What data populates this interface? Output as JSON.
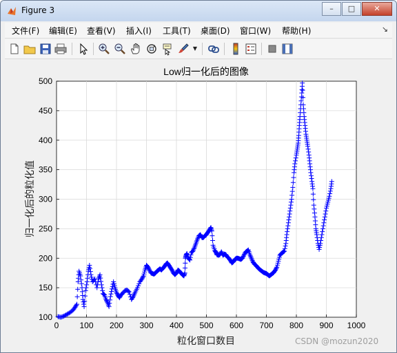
{
  "window": {
    "title": "Figure 3",
    "minimize_label": "–",
    "maximize_label": "□",
    "close_label": "✕"
  },
  "menu": [
    {
      "label": "文件(F)"
    },
    {
      "label": "编辑(E)"
    },
    {
      "label": "查看(V)"
    },
    {
      "label": "插入(I)"
    },
    {
      "label": "工具(T)"
    },
    {
      "label": "桌面(D)"
    },
    {
      "label": "窗口(W)"
    },
    {
      "label": "帮助(H)"
    }
  ],
  "menu_grip": "↘",
  "toolbar": {
    "icons": [
      "new-file-icon",
      "open-folder-icon",
      "save-icon",
      "print-icon",
      "pointer-icon",
      "zoom-in-icon",
      "zoom-out-icon",
      "pan-hand-icon",
      "rotate-3d-icon",
      "data-cursor-icon",
      "brush-icon",
      "brush-dropdown-icon",
      "link-plot-icon",
      "colorbar-icon",
      "legend-icon",
      "hide-plot-tools-icon",
      "show-plot-tools-icon"
    ]
  },
  "colors": {
    "marker": "#0000ff",
    "grid": "#d9d9d9",
    "axes_bg": "#ffffff",
    "figure_bg": "#f0f0f0"
  },
  "chart_data": {
    "type": "scatter",
    "title": "Low归一化后的图像",
    "xlabel": "粒化窗口数目",
    "ylabel": "归一化后的粒化值",
    "xlim": [
      0,
      1000
    ],
    "ylim": [
      100,
      500
    ],
    "xticks": [
      "0",
      "100",
      "200",
      "300",
      "400",
      "500",
      "600",
      "700",
      "800",
      "900",
      "1000"
    ],
    "yticks": [
      "100",
      "150",
      "200",
      "250",
      "300",
      "350",
      "400",
      "450",
      "500"
    ],
    "grid": true,
    "marker": "+",
    "series": [
      {
        "points": [
          [
            5,
            101
          ],
          [
            15,
            100
          ],
          [
            25,
            102
          ],
          [
            35,
            105
          ],
          [
            45,
            108
          ],
          [
            55,
            112
          ],
          [
            62,
            117
          ],
          [
            68,
            122
          ],
          [
            72,
            160
          ],
          [
            75,
            178
          ],
          [
            80,
            170
          ],
          [
            85,
            150
          ],
          [
            88,
            130
          ],
          [
            92,
            118
          ],
          [
            97,
            145
          ],
          [
            102,
            160
          ],
          [
            106,
            178
          ],
          [
            110,
            188
          ],
          [
            115,
            172
          ],
          [
            120,
            160
          ],
          [
            128,
            165
          ],
          [
            135,
            150
          ],
          [
            140,
            165
          ],
          [
            145,
            172
          ],
          [
            150,
            155
          ],
          [
            155,
            140
          ],
          [
            160,
            138
          ],
          [
            165,
            130
          ],
          [
            170,
            125
          ],
          [
            175,
            118
          ],
          [
            180,
            135
          ],
          [
            185,
            148
          ],
          [
            190,
            160
          ],
          [
            195,
            150
          ],
          [
            200,
            142
          ],
          [
            205,
            137
          ],
          [
            210,
            133
          ],
          [
            215,
            138
          ],
          [
            220,
            140
          ],
          [
            228,
            145
          ],
          [
            235,
            146
          ],
          [
            242,
            143
          ],
          [
            250,
            130
          ],
          [
            256,
            135
          ],
          [
            262,
            142
          ],
          [
            270,
            150
          ],
          [
            278,
            160
          ],
          [
            285,
            165
          ],
          [
            290,
            170
          ],
          [
            295,
            180
          ],
          [
            300,
            188
          ],
          [
            305,
            185
          ],
          [
            310,
            180
          ],
          [
            315,
            175
          ],
          [
            320,
            174
          ],
          [
            325,
            173
          ],
          [
            330,
            175
          ],
          [
            335,
            178
          ],
          [
            340,
            180
          ],
          [
            345,
            182
          ],
          [
            350,
            180
          ],
          [
            355,
            183
          ],
          [
            360,
            186
          ],
          [
            365,
            190
          ],
          [
            370,
            192
          ],
          [
            375,
            188
          ],
          [
            380,
            184
          ],
          [
            385,
            180
          ],
          [
            390,
            175
          ],
          [
            395,
            172
          ],
          [
            400,
            175
          ],
          [
            405,
            180
          ],
          [
            410,
            178
          ],
          [
            415,
            175
          ],
          [
            420,
            172
          ],
          [
            425,
            170
          ],
          [
            428,
            175
          ],
          [
            430,
            200
          ],
          [
            432,
            205
          ],
          [
            435,
            208
          ],
          [
            440,
            200
          ],
          [
            445,
            197
          ],
          [
            450,
            210
          ],
          [
            455,
            212
          ],
          [
            460,
            218
          ],
          [
            465,
            225
          ],
          [
            470,
            232
          ],
          [
            475,
            238
          ],
          [
            480,
            240
          ],
          [
            485,
            235
          ],
          [
            490,
            235
          ],
          [
            495,
            238
          ],
          [
            500,
            240
          ],
          [
            505,
            244
          ],
          [
            510,
            248
          ],
          [
            515,
            252
          ],
          [
            518,
            246
          ],
          [
            522,
            222
          ],
          [
            528,
            213
          ],
          [
            532,
            210
          ],
          [
            535,
            206
          ],
          [
            540,
            205
          ],
          [
            545,
            206
          ],
          [
            550,
            211
          ],
          [
            555,
            205
          ],
          [
            560,
            207
          ],
          [
            565,
            206
          ],
          [
            570,
            202
          ],
          [
            575,
            200
          ],
          [
            580,
            196
          ],
          [
            585,
            192
          ],
          [
            590,
            194
          ],
          [
            595,
            198
          ],
          [
            600,
            200
          ],
          [
            605,
            200
          ],
          [
            610,
            199
          ],
          [
            615,
            198
          ],
          [
            620,
            200
          ],
          [
            625,
            205
          ],
          [
            630,
            210
          ],
          [
            635,
            212
          ],
          [
            640,
            214
          ],
          [
            645,
            206
          ],
          [
            650,
            200
          ],
          [
            655,
            194
          ],
          [
            660,
            190
          ],
          [
            665,
            188
          ],
          [
            670,
            185
          ],
          [
            675,
            182
          ],
          [
            680,
            180
          ],
          [
            685,
            178
          ],
          [
            690,
            176
          ],
          [
            695,
            175
          ],
          [
            700,
            174
          ],
          [
            705,
            172
          ],
          [
            710,
            170
          ],
          [
            715,
            172
          ],
          [
            720,
            174
          ],
          [
            725,
            176
          ],
          [
            730,
            180
          ],
          [
            735,
            185
          ],
          [
            740,
            195
          ],
          [
            745,
            205
          ],
          [
            750,
            208
          ],
          [
            755,
            210
          ],
          [
            760,
            212
          ],
          [
            765,
            225
          ],
          [
            768,
            240
          ],
          [
            772,
            255
          ],
          [
            776,
            270
          ],
          [
            780,
            285
          ],
          [
            784,
            300
          ],
          [
            788,
            320
          ],
          [
            792,
            345
          ],
          [
            795,
            360
          ],
          [
            800,
            375
          ],
          [
            803,
            385
          ],
          [
            806,
            395
          ],
          [
            808,
            408
          ],
          [
            810,
            425
          ],
          [
            812,
            440
          ],
          [
            815,
            460
          ],
          [
            818,
            480
          ],
          [
            820,
            497
          ],
          [
            823,
            460
          ],
          [
            826,
            440
          ],
          [
            829,
            425
          ],
          [
            832,
            410
          ],
          [
            835,
            400
          ],
          [
            838,
            390
          ],
          [
            842,
            375
          ],
          [
            845,
            360
          ],
          [
            848,
            345
          ],
          [
            852,
            330
          ],
          [
            855,
            318
          ],
          [
            858,
            290
          ],
          [
            862,
            270
          ],
          [
            865,
            250
          ],
          [
            868,
            240
          ],
          [
            872,
            225
          ],
          [
            876,
            215
          ],
          [
            880,
            225
          ],
          [
            885,
            240
          ],
          [
            890,
            255
          ],
          [
            895,
            270
          ],
          [
            900,
            285
          ],
          [
            905,
            295
          ],
          [
            910,
            305
          ],
          [
            915,
            318
          ],
          [
            918,
            330
          ]
        ]
      }
    ]
  },
  "watermark": "CSDN @mozun2020"
}
